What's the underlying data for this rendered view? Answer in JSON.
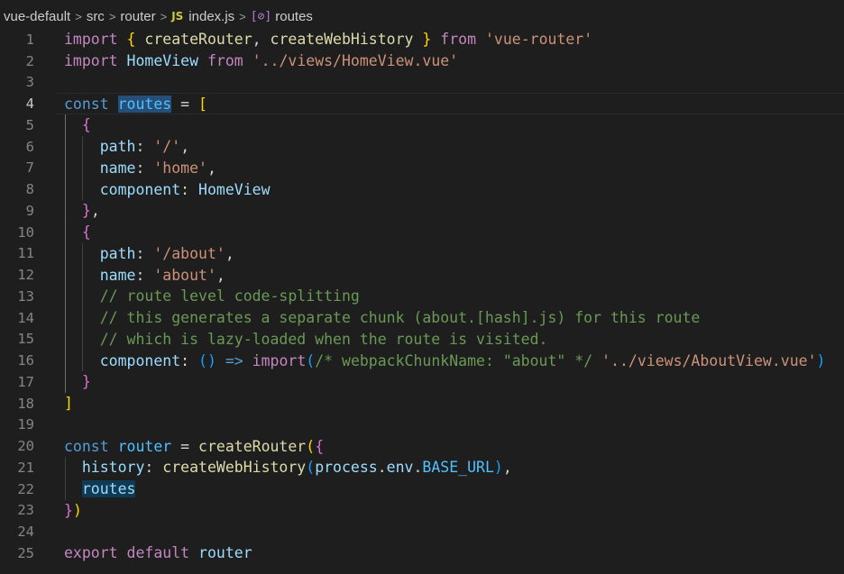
{
  "breadcrumb": {
    "items": [
      "vue-default",
      "src",
      "router",
      "index.js",
      "routes"
    ],
    "separator": ">",
    "file_icon_label": "JS",
    "symbol_icon_label": "[⊘]"
  },
  "editor": {
    "language": "javascript",
    "current_line": 4,
    "lines": [
      {
        "n": "1",
        "tokens": [
          [
            "kwc",
            "import"
          ],
          [
            "pl",
            " "
          ],
          [
            "b1",
            "{"
          ],
          [
            "pl",
            " "
          ],
          [
            "fn",
            "createRouter"
          ],
          [
            "pl",
            ", "
          ],
          [
            "fn",
            "createWebHistory"
          ],
          [
            "pl",
            " "
          ],
          [
            "b1",
            "}"
          ],
          [
            "pl",
            " "
          ],
          [
            "kwc",
            "from"
          ],
          [
            "pl",
            " "
          ],
          [
            "str",
            "'vue-router'"
          ]
        ]
      },
      {
        "n": "2",
        "tokens": [
          [
            "kwc",
            "import"
          ],
          [
            "pl",
            " "
          ],
          [
            "var",
            "HomeView"
          ],
          [
            "pl",
            " "
          ],
          [
            "kwc",
            "from"
          ],
          [
            "pl",
            " "
          ],
          [
            "str",
            "'../views/HomeView.vue'"
          ]
        ]
      },
      {
        "n": "3",
        "tokens": []
      },
      {
        "n": "4",
        "tokens": [
          [
            "kw",
            "const"
          ],
          [
            "pl",
            " "
          ],
          [
            "cst sel",
            "routes"
          ],
          [
            "pl",
            " = "
          ],
          [
            "b1",
            "["
          ]
        ]
      },
      {
        "n": "5",
        "tokens": [
          [
            "pl",
            "  "
          ],
          [
            "b2",
            "{"
          ]
        ]
      },
      {
        "n": "6",
        "tokens": [
          [
            "pl",
            "    "
          ],
          [
            "var",
            "path"
          ],
          [
            "pl",
            ": "
          ],
          [
            "str",
            "'/'"
          ],
          [
            "pl",
            ","
          ]
        ]
      },
      {
        "n": "7",
        "tokens": [
          [
            "pl",
            "    "
          ],
          [
            "var",
            "name"
          ],
          [
            "pl",
            ": "
          ],
          [
            "str",
            "'home'"
          ],
          [
            "pl",
            ","
          ]
        ]
      },
      {
        "n": "8",
        "tokens": [
          [
            "pl",
            "    "
          ],
          [
            "var",
            "component"
          ],
          [
            "pl",
            ": "
          ],
          [
            "var",
            "HomeView"
          ]
        ]
      },
      {
        "n": "9",
        "tokens": [
          [
            "pl",
            "  "
          ],
          [
            "b2",
            "}"
          ],
          [
            "pl",
            ","
          ]
        ]
      },
      {
        "n": "10",
        "tokens": [
          [
            "pl",
            "  "
          ],
          [
            "b2",
            "{"
          ]
        ]
      },
      {
        "n": "11",
        "tokens": [
          [
            "pl",
            "    "
          ],
          [
            "var",
            "path"
          ],
          [
            "pl",
            ": "
          ],
          [
            "str",
            "'/about'"
          ],
          [
            "pl",
            ","
          ]
        ]
      },
      {
        "n": "12",
        "tokens": [
          [
            "pl",
            "    "
          ],
          [
            "var",
            "name"
          ],
          [
            "pl",
            ": "
          ],
          [
            "str",
            "'about'"
          ],
          [
            "pl",
            ","
          ]
        ]
      },
      {
        "n": "13",
        "tokens": [
          [
            "pl",
            "    "
          ],
          [
            "cm",
            "// route level code-splitting"
          ]
        ]
      },
      {
        "n": "14",
        "tokens": [
          [
            "pl",
            "    "
          ],
          [
            "cm",
            "// this generates a separate chunk (about.[hash].js) for this route"
          ]
        ]
      },
      {
        "n": "15",
        "tokens": [
          [
            "pl",
            "    "
          ],
          [
            "cm",
            "// which is lazy-loaded when the route is visited."
          ]
        ]
      },
      {
        "n": "16",
        "tokens": [
          [
            "pl",
            "    "
          ],
          [
            "var",
            "component"
          ],
          [
            "pl",
            ": "
          ],
          [
            "b3",
            "()"
          ],
          [
            "pl",
            " "
          ],
          [
            "kw",
            "=>"
          ],
          [
            "pl",
            " "
          ],
          [
            "kwc",
            "import"
          ],
          [
            "b3",
            "("
          ],
          [
            "cm",
            "/* webpackChunkName: \"about\" */"
          ],
          [
            "pl",
            " "
          ],
          [
            "str",
            "'../views/AboutView.vue'"
          ],
          [
            "b3",
            ")"
          ]
        ]
      },
      {
        "n": "17",
        "tokens": [
          [
            "pl",
            "  "
          ],
          [
            "b2",
            "}"
          ]
        ]
      },
      {
        "n": "18",
        "tokens": [
          [
            "b1",
            "]"
          ]
        ]
      },
      {
        "n": "19",
        "tokens": []
      },
      {
        "n": "20",
        "tokens": [
          [
            "kw",
            "const"
          ],
          [
            "pl",
            " "
          ],
          [
            "cst",
            "router"
          ],
          [
            "pl",
            " = "
          ],
          [
            "fn",
            "createRouter"
          ],
          [
            "b1",
            "("
          ],
          [
            "b2",
            "{"
          ]
        ]
      },
      {
        "n": "21",
        "tokens": [
          [
            "pl",
            "  "
          ],
          [
            "var",
            "history"
          ],
          [
            "pl",
            ": "
          ],
          [
            "fn",
            "createWebHistory"
          ],
          [
            "b3",
            "("
          ],
          [
            "var",
            "process"
          ],
          [
            "pl",
            "."
          ],
          [
            "var",
            "env"
          ],
          [
            "pl",
            "."
          ],
          [
            "cst",
            "BASE_URL"
          ],
          [
            "b3",
            ")"
          ],
          [
            "pl",
            ","
          ]
        ]
      },
      {
        "n": "22",
        "tokens": [
          [
            "pl",
            "  "
          ],
          [
            "var sel2",
            "routes"
          ]
        ]
      },
      {
        "n": "23",
        "tokens": [
          [
            "b2",
            "}"
          ],
          [
            "b1",
            ")"
          ]
        ]
      },
      {
        "n": "24",
        "tokens": []
      },
      {
        "n": "25",
        "tokens": [
          [
            "kwc",
            "export"
          ],
          [
            "pl",
            " "
          ],
          [
            "kwc",
            "default"
          ],
          [
            "pl",
            " "
          ],
          [
            "var",
            "router"
          ]
        ]
      }
    ]
  }
}
